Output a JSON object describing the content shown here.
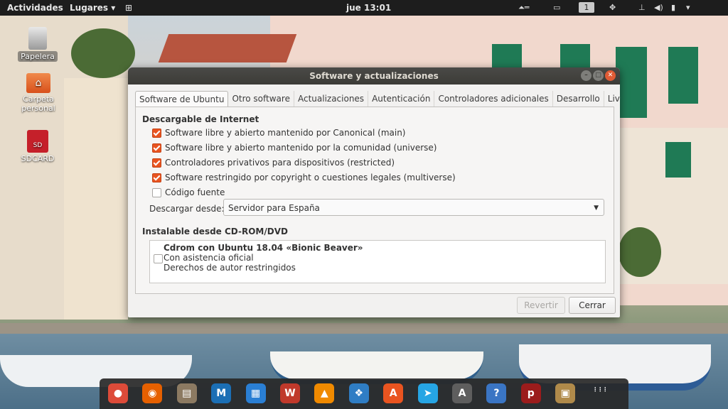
{
  "topbar": {
    "activities": "Actividades",
    "places": "Lugares",
    "places_arrow": "▾",
    "apps_grid_glyph": "⊞",
    "clock": "jue 13:01",
    "workspace": "1",
    "status_icons": [
      "arrow-up-icon",
      "screen-icon",
      "workspace-indicator",
      "network-icon",
      "volume-icon",
      "battery-icon",
      "chevron-down-icon"
    ]
  },
  "desktop_icons": [
    {
      "name": "trash",
      "label": "Papelera"
    },
    {
      "name": "personal-folder",
      "label": "Carpeta personal"
    },
    {
      "name": "sdcard",
      "label": "SDCARD"
    }
  ],
  "dialog": {
    "title": "Software y actualizaciones",
    "tabs": [
      {
        "label": "Software de Ubuntu",
        "active": true
      },
      {
        "label": "Otro software",
        "active": false
      },
      {
        "label": "Actualizaciones",
        "active": false
      },
      {
        "label": "Autenticación",
        "active": false
      },
      {
        "label": "Controladores adicionales",
        "active": false
      },
      {
        "label": "Desarrollo",
        "active": false
      },
      {
        "label": "Livepatch",
        "active": false
      }
    ],
    "internet_section": "Descargable de Internet",
    "checks": [
      {
        "label": "Software libre y abierto mantenido por Canonical (main)",
        "checked": true
      },
      {
        "label": "Software libre y abierto mantenido por la comunidad (universe)",
        "checked": true
      },
      {
        "label": "Controladores privativos para dispositivos (restricted)",
        "checked": true
      },
      {
        "label": "Software restringido por copyright o cuestiones legales (multiverse)",
        "checked": true
      },
      {
        "label": "Código fuente",
        "checked": false
      }
    ],
    "download_from_label": "Descargar desde:",
    "download_from_value": "Servidor para España",
    "cdrom_section": "Instalable desde CD-ROM/DVD",
    "cdrom": {
      "line1": "Cdrom con Ubuntu 18.04 «Bionic Beaver»",
      "line2": "Con asistencia oficial",
      "line3": "Derechos de autor restringidos",
      "checked": false
    },
    "revert_label": "Revertir",
    "close_label": "Cerrar"
  },
  "dock": {
    "apps": [
      {
        "name": "chrome-icon",
        "glyph": "●",
        "color": "#dd4b39"
      },
      {
        "name": "firefox-icon",
        "glyph": "◉",
        "color": "#e66000"
      },
      {
        "name": "files-icon",
        "glyph": "▤",
        "color": "#8c7a62"
      },
      {
        "name": "mindmap-icon",
        "glyph": "M",
        "color": "#1b6fb5"
      },
      {
        "name": "writer-icon",
        "glyph": "▦",
        "color": "#2a7fd4"
      },
      {
        "name": "wps-icon",
        "glyph": "W",
        "color": "#c0392b"
      },
      {
        "name": "vlc-icon",
        "glyph": "▲",
        "color": "#f08a00"
      },
      {
        "name": "shotwell-icon",
        "glyph": "❖",
        "color": "#2f7dc4"
      },
      {
        "name": "software-center-icon",
        "glyph": "A",
        "color": "#e95420"
      },
      {
        "name": "telegram-icon",
        "glyph": "➤",
        "color": "#26a5e4"
      },
      {
        "name": "updater-icon",
        "glyph": "A",
        "color": "#5e5e5e"
      },
      {
        "name": "help-icon",
        "glyph": "?",
        "color": "#3a75c4"
      },
      {
        "name": "pdftk-icon",
        "glyph": "p",
        "color": "#9b1c1c"
      },
      {
        "name": "archive-icon",
        "glyph": "▣",
        "color": "#b08a4a"
      },
      {
        "name": "show-apps-icon",
        "glyph": "⋮⋮⋮",
        "color": "#3a3a3a"
      }
    ]
  }
}
